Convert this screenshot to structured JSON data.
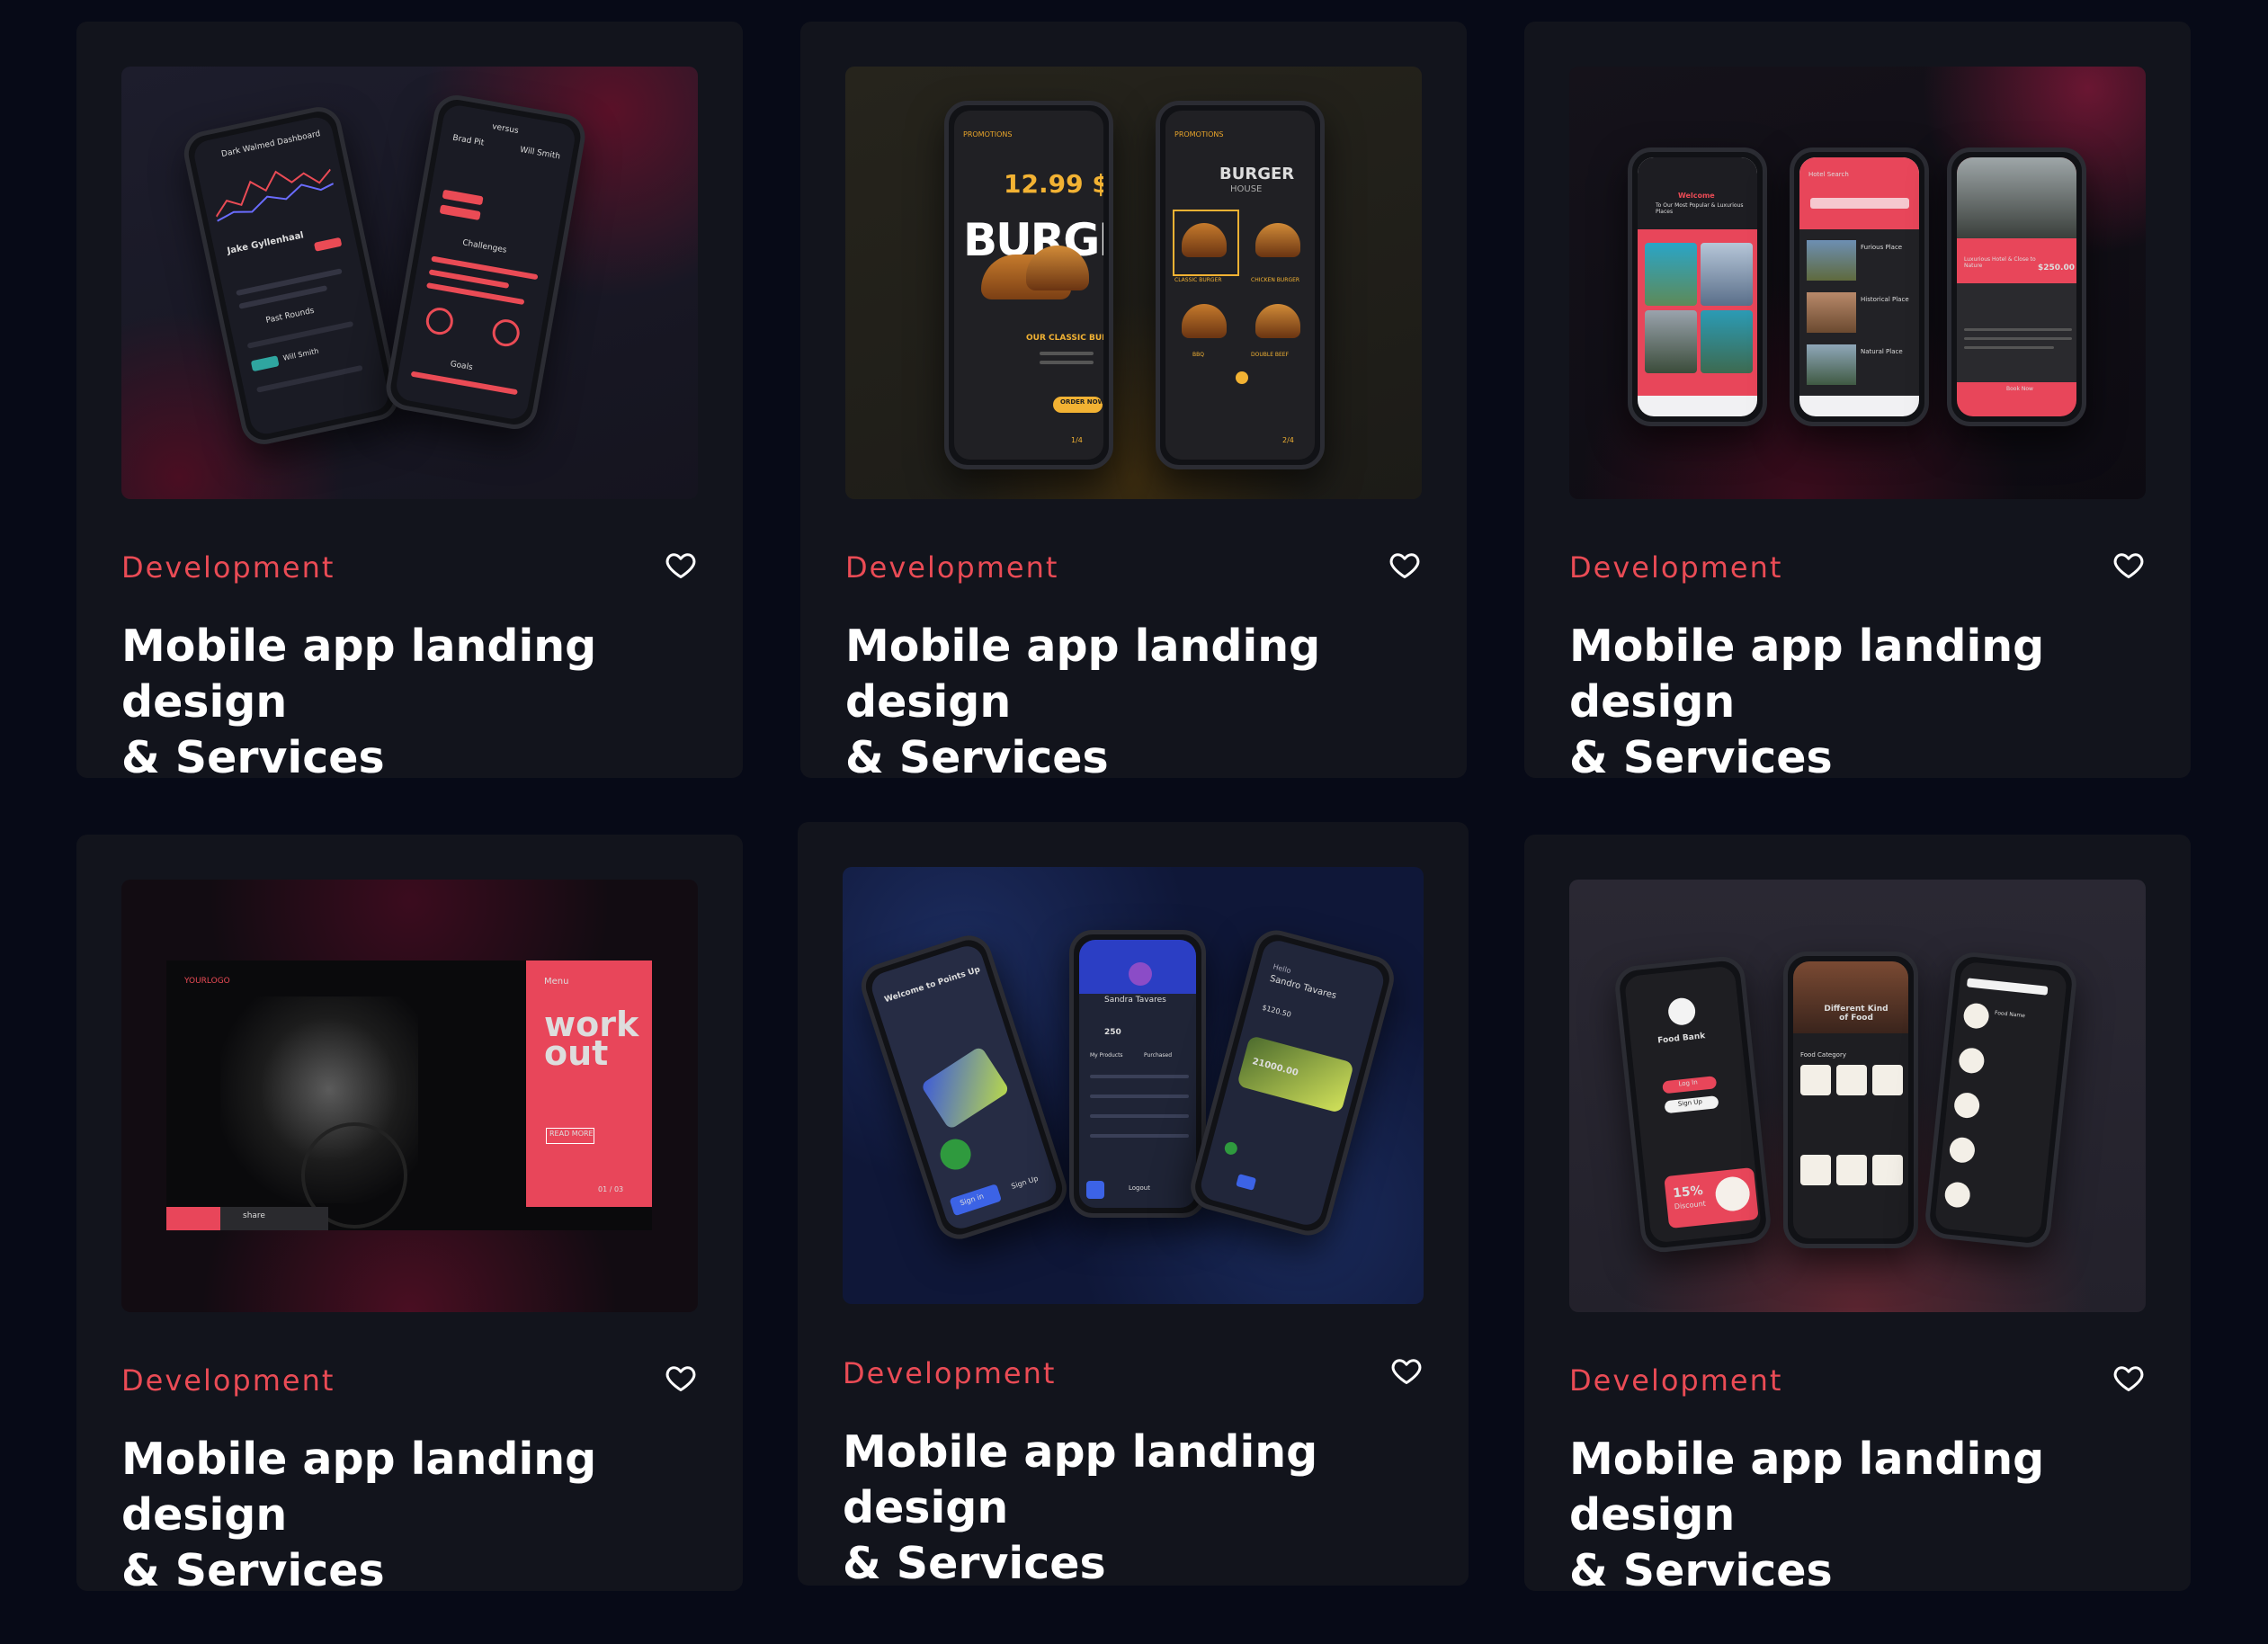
{
  "cards": [
    {
      "category": "Development",
      "title_line1": "Mobile app landing design",
      "title_line2": "& Services",
      "thumb": {
        "left_phone": {
          "header": "Dark Walmed Dashboard",
          "name": "Jake Gyllenhaal",
          "section1": "Past Rounds",
          "item": "Will Smith"
        },
        "right_phone": {
          "header": "versus",
          "player_a": "Brad Pit",
          "player_b": "Will Smith",
          "section": "Challenges",
          "goals": "Goals"
        }
      }
    },
    {
      "category": "Development",
      "title_line1": "Mobile app landing design",
      "title_line2": "& Services",
      "thumb": {
        "left_phone": {
          "nav": "PROMOTIONS",
          "price": "12.99 $",
          "headline": "BURGER",
          "subtitle": "OUR CLASSIC BURGER",
          "cta": "ORDER NOW",
          "page": "1/4"
        },
        "right_phone": {
          "nav": "PROMOTIONS",
          "headline": "BURGER",
          "sub": "HOUSE",
          "items": [
            "CLASSIC BURGER",
            "CHICKEN BURGER",
            "BBQ",
            "DOUBLE BEEF"
          ],
          "page": "2/4"
        }
      }
    },
    {
      "category": "Development",
      "title_line1": "Mobile app landing design",
      "title_line2": "& Services",
      "thumb": {
        "phone1": {
          "greeting": "Welcome",
          "text": "To Our Most Popular & Luxurious Places"
        },
        "phone2": {
          "header": "Hotel Search",
          "items": [
            "Furious Place",
            "Historical Place",
            "Natural Place"
          ]
        },
        "phone3": {
          "title": "Luxurious Hotel & Close to Nature",
          "price": "$250.00",
          "cta": "Book Now"
        }
      }
    },
    {
      "category": "Development",
      "title_line1": "Mobile app landing design",
      "title_line2": "& Services",
      "thumb": {
        "logo": "YOURLOGO",
        "menu": "Menu",
        "headline1": "work",
        "headline2": "out",
        "cta": "READ MORE",
        "share": "share",
        "page": "01 / 03"
      }
    },
    {
      "category": "Development",
      "title_line1": "Mobile app landing design",
      "title_line2": "& Services",
      "thumb": {
        "phone1": {
          "title": "Welcome to Points Up",
          "btn1": "Sign in",
          "btn2": "Sign Up"
        },
        "phone2": {
          "name": "Sandra Tavares",
          "points": "250",
          "tab1": "My Products",
          "tab2": "Purchased",
          "logout": "Logout"
        },
        "phone3": {
          "greeting": "Hello",
          "name": "Sandro Tavares",
          "amount": "21000.00",
          "balance": "$120.50"
        }
      }
    },
    {
      "category": "Development",
      "title_line1": "Mobile app landing design",
      "title_line2": "& Services",
      "thumb": {
        "phone1": {
          "title": "Food Bank",
          "login": "Log In",
          "signup": "Sign Up",
          "promo": "15%",
          "promo_sub": "Discount"
        },
        "phone2": {
          "headline": "Different Kind of Food",
          "section": "Food Category"
        },
        "phone3": {
          "section": "Food Name"
        }
      }
    }
  ],
  "colors": {
    "background": "#070a17",
    "card": "#12141c",
    "accent": "#ea4b55",
    "title": "#ffffff"
  },
  "icons": {
    "favorite": "heart-outline-icon"
  }
}
